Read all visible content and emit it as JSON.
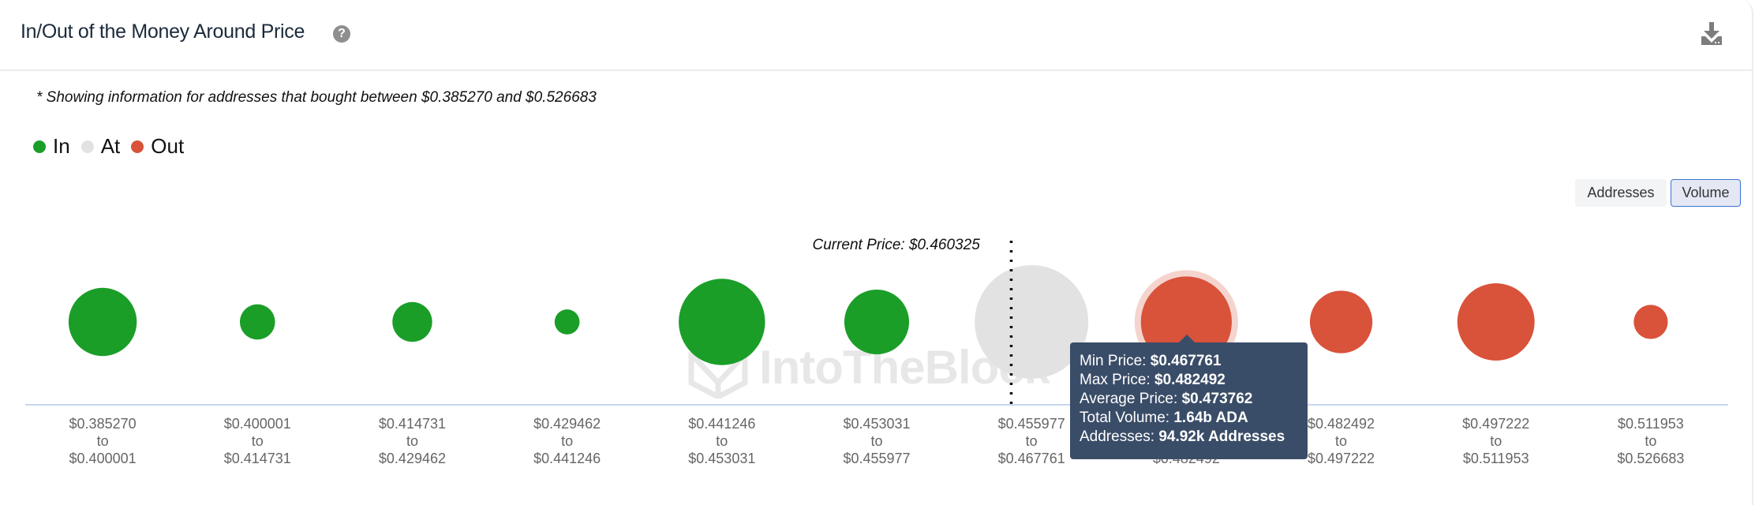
{
  "header": {
    "title": "In/Out of the Money Around Price",
    "help_icon": "question-circle-icon",
    "download_icon": "download-icon"
  },
  "subtitle": "* Showing information for addresses that bought between $0.385270 and $0.526683",
  "legend": [
    {
      "label": "In",
      "color": "#1a9e28"
    },
    {
      "label": "At",
      "color": "#e2e2e2"
    },
    {
      "label": "Out",
      "color": "#d9523a"
    }
  ],
  "toggles": {
    "addresses_label": "Addresses",
    "volume_label": "Volume",
    "selected": "Volume"
  },
  "watermark": "IntoTheBlock",
  "tooltip": {
    "lines": [
      {
        "label": "Min Price: ",
        "value": "$0.467761"
      },
      {
        "label": "Max Price: ",
        "value": "$0.482492"
      },
      {
        "label": "Average Price: ",
        "value": "$0.473762"
      },
      {
        "label": "Total Volume: ",
        "value": "1.64b ADA"
      },
      {
        "label": "Addresses: ",
        "value": "94.92k Addresses"
      }
    ]
  },
  "chart_data": {
    "type": "scatter",
    "subtype": "bubble",
    "title": "In/Out of the Money Around Price",
    "metric": "Volume",
    "current_price_label": "Current Price: $0.460325",
    "current_price": 0.460325,
    "range": [
      "$0.385270",
      "$0.526683"
    ],
    "categories": [
      {
        "from": "$0.385270",
        "to": "$0.400001",
        "status": "In",
        "relative_size": 0.6
      },
      {
        "from": "$0.400001",
        "to": "$0.414731",
        "status": "In",
        "relative_size": 0.31
      },
      {
        "from": "$0.414731",
        "to": "$0.429462",
        "status": "In",
        "relative_size": 0.35
      },
      {
        "from": "$0.429462",
        "to": "$0.441246",
        "status": "In",
        "relative_size": 0.22
      },
      {
        "from": "$0.441246",
        "to": "$0.453031",
        "status": "In",
        "relative_size": 0.76
      },
      {
        "from": "$0.453031",
        "to": "$0.455977",
        "status": "In",
        "relative_size": 0.57
      },
      {
        "from": "$0.455977",
        "to": "$0.467761",
        "status": "At",
        "relative_size": 1.0
      },
      {
        "from": "$0.467761",
        "to": "$0.482492",
        "status": "Out",
        "relative_size": 0.8,
        "highlighted": true,
        "total_volume": "1.64b ADA",
        "addresses": "94.92k Addresses",
        "average_price": "$0.473762"
      },
      {
        "from": "$0.482492",
        "to": "$0.497222",
        "status": "Out",
        "relative_size": 0.55
      },
      {
        "from": "$0.497222",
        "to": "$0.511953",
        "status": "Out",
        "relative_size": 0.68
      },
      {
        "from": "$0.511953",
        "to": "$0.526683",
        "status": "Out",
        "relative_size": 0.3
      }
    ],
    "tick_connector": "to",
    "legend_position": "top-left",
    "grid": false
  }
}
